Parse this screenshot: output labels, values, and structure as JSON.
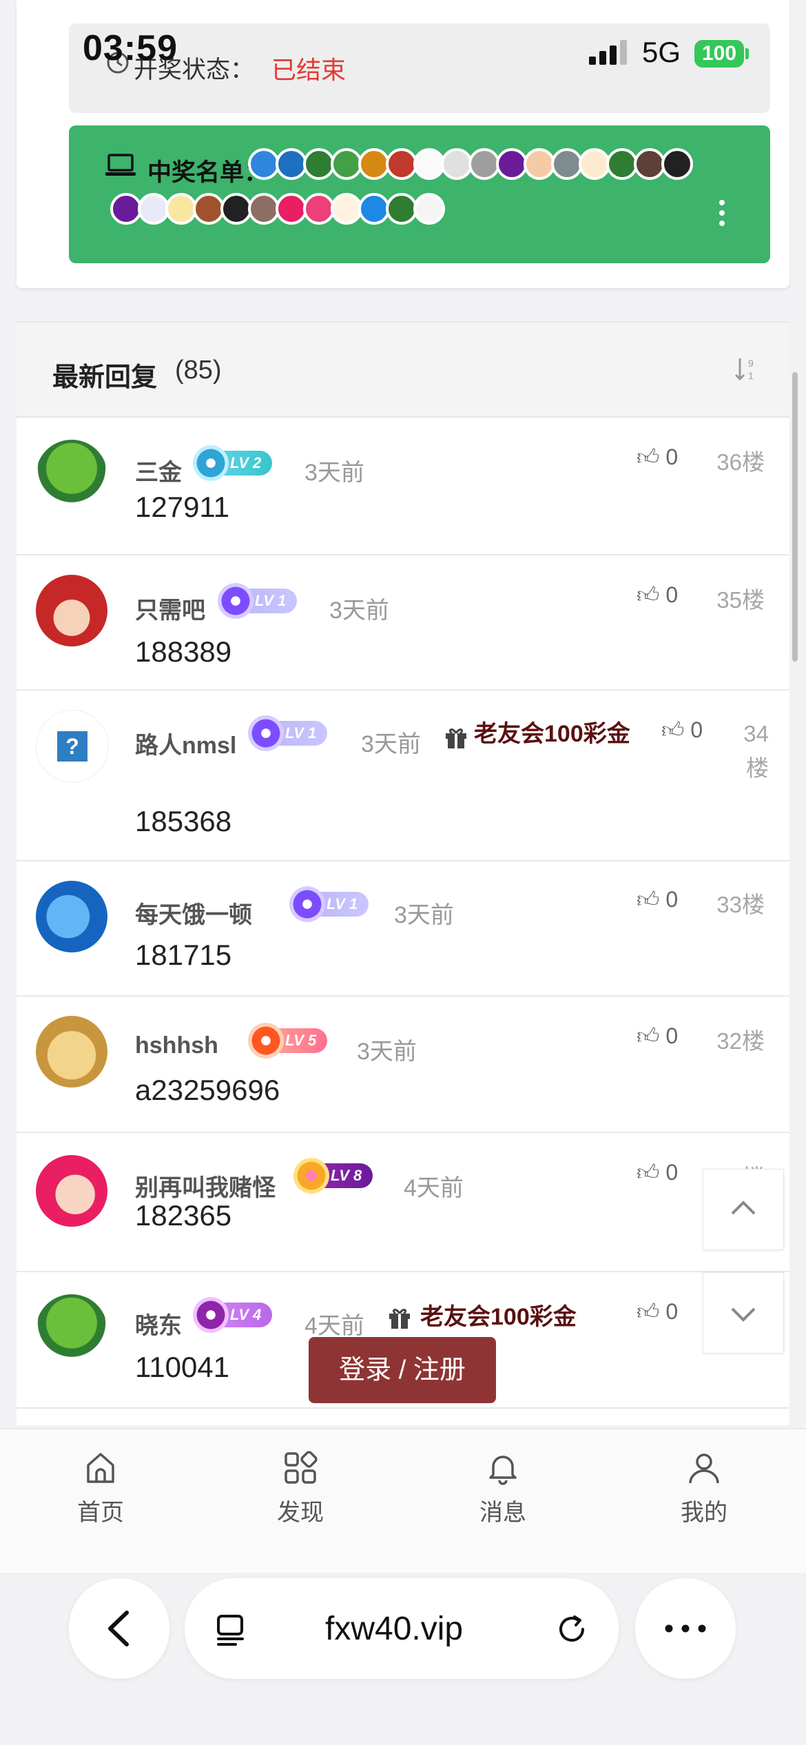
{
  "status_bar": {
    "time": "03:59",
    "network": "5G",
    "battery": "100"
  },
  "lottery": {
    "state_label": "开奖状态：",
    "state_value": "已结束",
    "winners_label": "中奖名单："
  },
  "replies": {
    "title": "最新回复",
    "count": "(85)",
    "items": [
      {
        "name": "三金",
        "level": "LV 2",
        "time": "3天前",
        "content": "127911",
        "likes": "0",
        "floor": "36楼",
        "gift": ""
      },
      {
        "name": "只需吧",
        "level": "LV 1",
        "time": "3天前",
        "content": "188389",
        "likes": "0",
        "floor": "35楼",
        "gift": ""
      },
      {
        "name": "路人nmsl",
        "level": "LV 1",
        "time": "3天前",
        "content": "185368",
        "likes": "0",
        "floor": "34楼",
        "gift": "老友会100彩金"
      },
      {
        "name": "每天饿一顿",
        "level": "LV 1",
        "time": "3天前",
        "content": "181715",
        "likes": "0",
        "floor": "33楼",
        "gift": ""
      },
      {
        "name": "hshhsh",
        "level": "LV 5",
        "time": "3天前",
        "content": "a23259696",
        "likes": "0",
        "floor": "32楼",
        "gift": ""
      },
      {
        "name": "别再叫我赌怪",
        "level": "LV 8",
        "time": "4天前",
        "content": "182365",
        "likes": "0",
        "floor": "31楼",
        "gift": ""
      },
      {
        "name": "晓东",
        "level": "LV 4",
        "time": "4天前",
        "content": "110041",
        "likes": "0",
        "floor": "",
        "gift": "老友会100彩金"
      }
    ]
  },
  "login_button": "登录 / 注册",
  "bottom_nav": [
    {
      "label": "首页",
      "icon": "home-icon"
    },
    {
      "label": "发现",
      "icon": "discover-icon"
    },
    {
      "label": "消息",
      "icon": "bell-icon"
    },
    {
      "label": "我的",
      "icon": "user-icon"
    }
  ],
  "browser": {
    "url": "fxw40.vip"
  },
  "colors": {
    "winners_bg": "#3db36b",
    "state_red": "#e53935",
    "login_bg": "#8f3434",
    "gift_text": "#5b1010"
  }
}
